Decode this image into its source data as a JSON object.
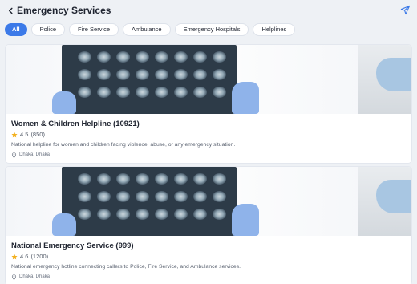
{
  "header": {
    "title": "Emergency Services"
  },
  "filters": [
    {
      "label": "All",
      "active": true
    },
    {
      "label": "Police",
      "active": false
    },
    {
      "label": "Fire Service",
      "active": false
    },
    {
      "label": "Ambulance",
      "active": false
    },
    {
      "label": "Emergency Hospitals",
      "active": false
    },
    {
      "label": "Helplines",
      "active": false
    }
  ],
  "services": [
    {
      "title": "Women & Children Helpline (10921)",
      "rating": "4.5",
      "reviews": "(850)",
      "description": "National helpline for women and children facing violence, abuse, or any emergency situation.",
      "location": "Dhaka, Dhaka"
    },
    {
      "title": "National Emergency Service (999)",
      "rating": "4.6",
      "reviews": "(1200)",
      "description": "National emergency hotline connecting callers to Police, Fire Service, and Ambulance services.",
      "location": "Dhaka, Dhaka"
    }
  ],
  "colors": {
    "accent": "#3c7ae8",
    "star": "#f2b01e",
    "background": "#eef1f5"
  },
  "icons": {
    "back": "chevron-left-icon",
    "share": "send-icon",
    "rating": "star-icon",
    "location": "map-pin-icon"
  }
}
